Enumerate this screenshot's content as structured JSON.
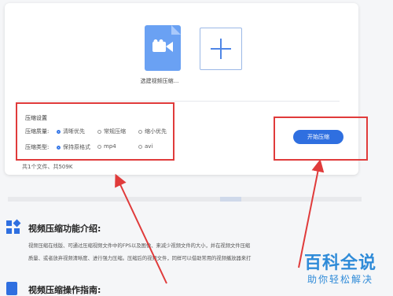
{
  "upload": {
    "file_caption": "选建视频压缩...",
    "add_tile_icon": "plus-icon",
    "file_icon": "video-camera-icon"
  },
  "settings": {
    "title": "压缩设置",
    "quality": {
      "label": "压缩质量:",
      "options": [
        "清晰优先",
        "常规压缩",
        "缩小优先"
      ],
      "selected": "清晰优先"
    },
    "format": {
      "label": "压缩类型:",
      "options": [
        "保持原格式",
        "mp4",
        "avi"
      ],
      "selected": "保持原格式"
    }
  },
  "actions": {
    "start_label": "开始压缩"
  },
  "footer": {
    "file_summary": "共1个文件、共509K"
  },
  "article": {
    "intro_title": "视频压缩功能介绍:",
    "intro_line1": "视频压缩在线版、可通过压缩视频文件中的FPS以及图像、来减少视频文件的大小，并在视频文件压缩",
    "intro_line2": "质量、或者放弃视频清晰度、进行强力压缩。压缩后的视频文件，同样可以借助常用的视频播放器来打",
    "guide_title": "视频压缩操作指南:"
  },
  "watermark": {
    "main": "百科全说",
    "sub": "助你轻松解决"
  },
  "colors": {
    "accent": "#2f6fe0",
    "highlight": "#e03b3b",
    "watermark": "#2f8bd8"
  }
}
